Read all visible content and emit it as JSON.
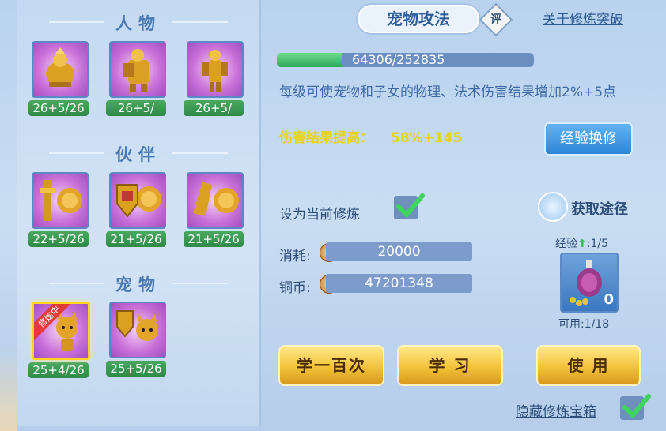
{
  "sections": {
    "character": {
      "title": "人物",
      "items": [
        {
          "level": "26+5/26",
          "icon": "golden-warrior-seated"
        },
        {
          "level": "26+5/",
          "icon": "golden-warrior-shield"
        },
        {
          "level": "26+5/",
          "icon": "golden-warrior-standing"
        }
      ]
    },
    "partner": {
      "title": "伙伴",
      "items": [
        {
          "level": "22+5/26",
          "icon": "lion-sword"
        },
        {
          "level": "21+5/26",
          "icon": "lion-shield"
        },
        {
          "level": "21+5/26",
          "icon": "lion-paw"
        }
      ]
    },
    "pet": {
      "title": "宠物",
      "items": [
        {
          "level": "25+4/26",
          "icon": "cat-attack",
          "tag": "修炼中",
          "selected": true
        },
        {
          "level": "25+5/26",
          "icon": "cat-shield"
        }
      ]
    }
  },
  "tab": {
    "title": "宠物攻法",
    "badge": "评"
  },
  "about_link": "关于修炼突破",
  "progress": {
    "text": "64306/252835",
    "current": 64306,
    "max": 252835
  },
  "description": "每级可使宠物和子女的物理、法术伤害结果增加2%+5点",
  "bonus": {
    "label": "伤害结果提高：",
    "value": "58%+145"
  },
  "exp_exchange_button": "经验换修",
  "set_current": {
    "label": "设为当前修炼",
    "checked": true
  },
  "obtain": {
    "label": "获取途径"
  },
  "cost": {
    "label": "消耗:",
    "value": "20000"
  },
  "copper": {
    "label": "铜币:",
    "value": "47201348"
  },
  "exp_item": {
    "label": "经验",
    "count": ":1/5",
    "quantity": "0",
    "available": "可用:1/18"
  },
  "buttons": {
    "learn_hundred": "学一百次",
    "learn": "学 习",
    "use": "使 用"
  },
  "hide_box": {
    "label": "隐藏修炼宝箱",
    "checked": true
  },
  "colors": {
    "accent_green": "#2fa85b",
    "button_gold": "#f3c23a",
    "button_blue": "#2d86d8",
    "panel_bg": "#c4daf2"
  }
}
